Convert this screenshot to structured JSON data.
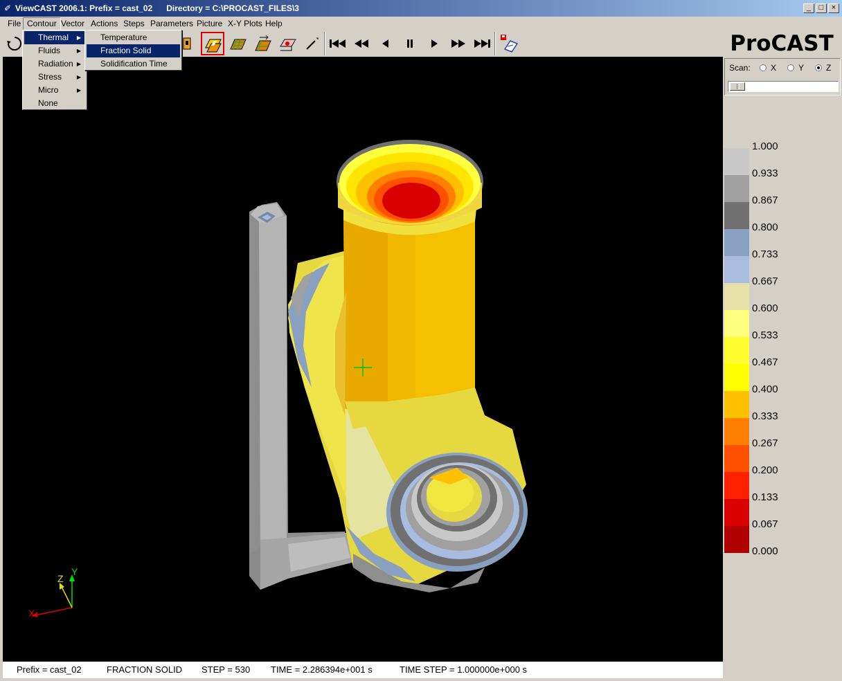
{
  "window": {
    "title": "ViewCAST 2006.1: Prefix = cast_02      Directory = C:\\PROCAST_FILES\\3",
    "buttons": [
      "minimize",
      "maximize",
      "close"
    ]
  },
  "menubar": {
    "items": [
      "File",
      "Contour",
      "Vector",
      "Actions",
      "Steps",
      "Parameters",
      "Picture",
      "X-Y Plots",
      "Help"
    ],
    "open_item": "Contour"
  },
  "contour_menu": {
    "items": [
      "Thermal",
      "Fluids",
      "Radiation",
      "Stress",
      "Micro",
      "None"
    ],
    "highlighted": "Thermal"
  },
  "thermal_submenu": {
    "items": [
      "Temperature",
      "Fraction Solid",
      "Solidification Time"
    ],
    "highlighted": "Fraction Solid"
  },
  "toolbar": {
    "icons": [
      "rotate-icon",
      "select-icon",
      "shaded-contour-icon",
      "mesh-contour-icon",
      "vector-contour-icon",
      "cut-icon",
      "probe-icon",
      "first-step-icon",
      "fast-rewind-icon",
      "step-back-icon",
      "pause-icon",
      "play-icon",
      "fast-forward-icon",
      "last-step-icon",
      "save-image-icon"
    ],
    "selected": "shaded-contour-icon"
  },
  "logo": "ProCAST",
  "scan": {
    "label": "Scan:",
    "options": [
      "X",
      "Y",
      "Z"
    ],
    "selected": "Z",
    "slider_value": 0.0
  },
  "legend": {
    "values": [
      "1.000",
      "0.933",
      "0.867",
      "0.800",
      "0.733",
      "0.667",
      "0.600",
      "0.533",
      "0.467",
      "0.400",
      "0.333",
      "0.267",
      "0.200",
      "0.133",
      "0.067",
      "0.000"
    ],
    "colors": [
      "#c8c8c8",
      "#a0a0a0",
      "#707070",
      "#8aa0c0",
      "#a8bce0",
      "#e6e2a8",
      "#ffff80",
      "#ffff30",
      "#ffff00",
      "#ffc000",
      "#ff8000",
      "#ff5000",
      "#ff2000",
      "#d80000",
      "#b00000"
    ]
  },
  "axes": {
    "labels": [
      "Z",
      "Y",
      "X"
    ]
  },
  "status": {
    "prefix": "Prefix = cast_02",
    "quantity": "FRACTION SOLID",
    "step": "STEP = 530",
    "time": "TIME = 2.286394e+001 s",
    "time_step": "TIME STEP = 1.000000e+000 s"
  }
}
